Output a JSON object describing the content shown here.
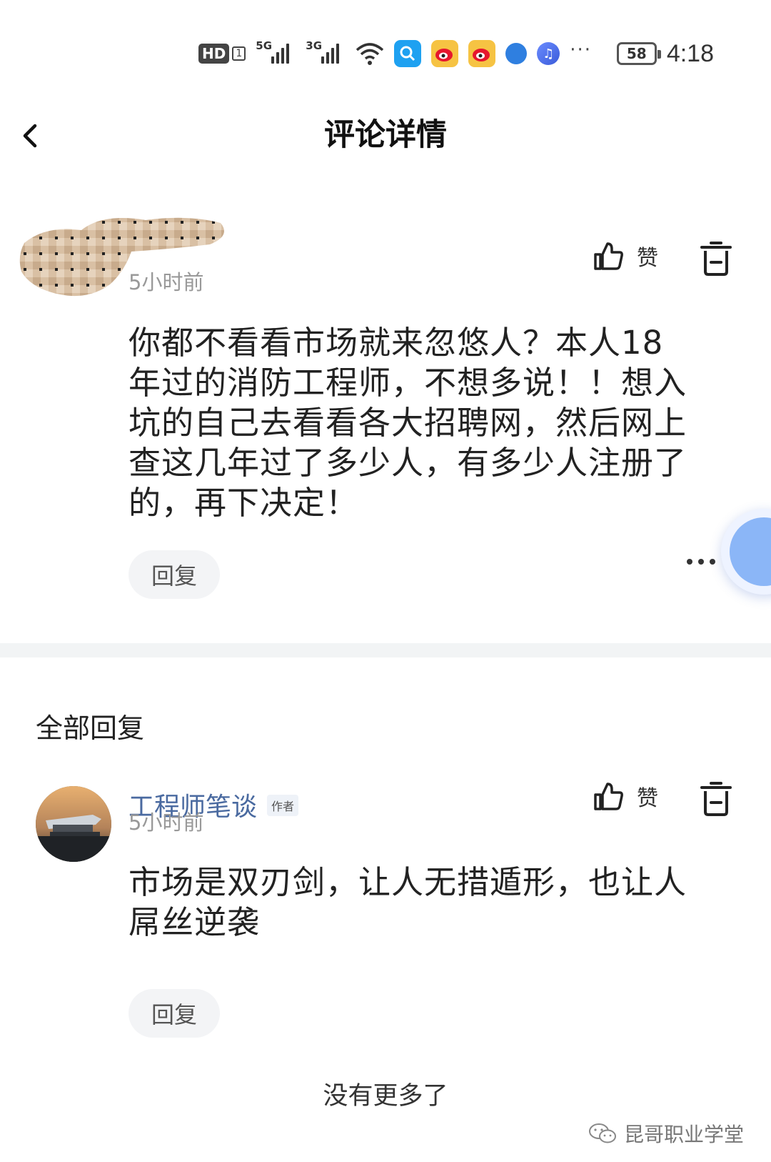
{
  "status_bar": {
    "hd": "HD",
    "sim": "1",
    "network_1": "5G",
    "network_2": "3G",
    "battery": "58",
    "time": "4:18",
    "more": "···"
  },
  "header": {
    "title": "评论详情"
  },
  "main_comment": {
    "time": "5小时前",
    "like_label": "赞",
    "text_lines": [
      "你都不看看市场就来忽悠人？本人18",
      "年过的消防工程师，不想多说！！想入",
      "坑的自己去看看各大招聘网，然后网上",
      "查这几年过了多少人，有多少人注册了",
      "的，再下决定！"
    ],
    "reply_label": "回复"
  },
  "replies_section": {
    "title": "全部回复",
    "items": [
      {
        "author": "工程师笔谈",
        "badge": "作者",
        "time": "5小时前",
        "like_label": "赞",
        "text_lines": [
          "市场是双刃剑，让人无措遁形，也让人",
          "屌丝逆袭"
        ],
        "reply_label": "回复"
      }
    ]
  },
  "footer": {
    "no_more": "没有更多了",
    "watermark": "昆哥职业学堂"
  },
  "colors": {
    "author_name": "#4a6aa0",
    "time_gray": "#999999",
    "divider": "#f2f4f5",
    "reply_btn_bg": "#f3f4f6"
  }
}
